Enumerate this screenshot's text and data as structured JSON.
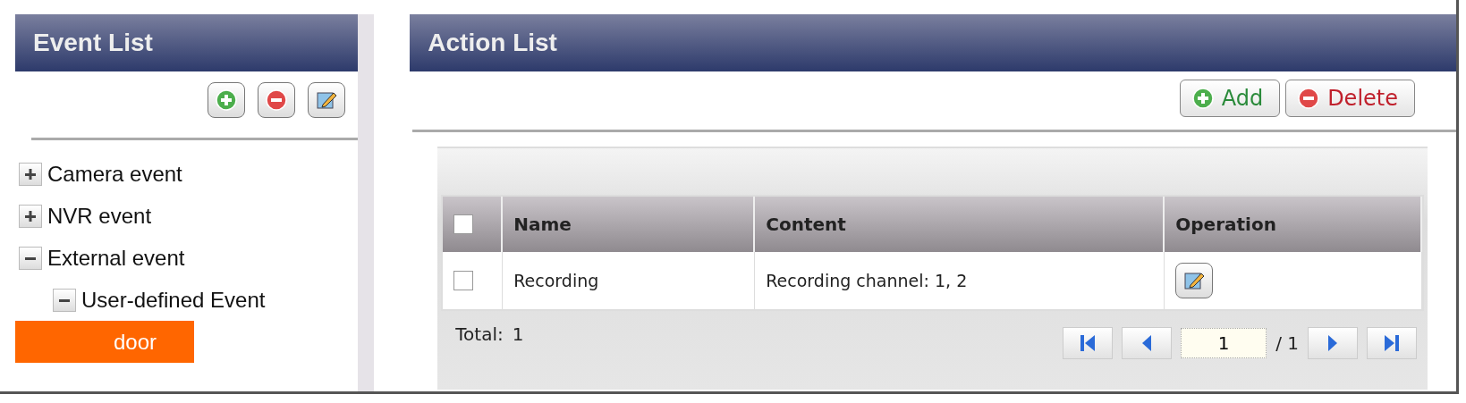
{
  "event_list": {
    "title": "Event List",
    "tree": [
      {
        "label": "Camera event",
        "expanded": false,
        "selected": false
      },
      {
        "label": "NVR event",
        "expanded": false,
        "selected": false
      },
      {
        "label": "External event",
        "expanded": true,
        "selected": false,
        "children": [
          {
            "label": "User-defined Event",
            "expanded": true,
            "selected": false,
            "children": [
              {
                "label": "door",
                "selected": true
              }
            ]
          }
        ]
      }
    ]
  },
  "action_list": {
    "title": "Action List",
    "buttons": [
      {
        "label": "Add",
        "kind": "add"
      },
      {
        "label": "Delete",
        "kind": "delete"
      }
    ],
    "table": {
      "columns": [
        "Name",
        "Content",
        "Operation"
      ],
      "header_checked": false,
      "rows": [
        {
          "checked": false,
          "name": "Recording",
          "content": "Recording channel: 1, 2"
        }
      ]
    },
    "footer": {
      "total_label": "Total:",
      "total": "1",
      "page": "1",
      "pages": "/ 1"
    }
  }
}
